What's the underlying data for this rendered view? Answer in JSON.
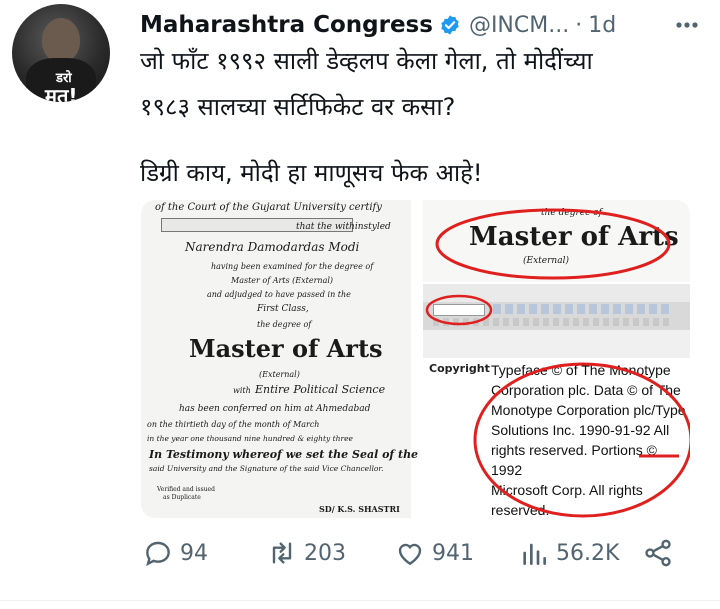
{
  "tweet": {
    "account_name": "Maharashtra Congress",
    "handle": "@INCM...",
    "separator": "·",
    "time": "1d",
    "avatar_text_top": "डरो",
    "avatar_text_bottom": "मत!",
    "lines": [
      "जो फाँट १९९२ साली डेव्हलप केला गेला, तो मोदींच्या",
      "१९८३ सालच्या सर्टिफिकेट वर कसा?",
      "डिग्री काय, मोदी हा माणूसच फेक आहे!"
    ]
  },
  "media": {
    "certificate": {
      "line1": "of the Court of the Gujarat University certify",
      "line2": "that the withinstyled",
      "name": "Narendra Damodardas Modi",
      "line3": "having been examined for the degree of",
      "line4": "Master of Arts (External)",
      "line5": "and adjudged to have passed in the",
      "class": "First Class,",
      "line6": "the degree of",
      "degree": "Master of Arts",
      "external": "(External)",
      "subject_prefix": "with",
      "subject": "Entire Political Science",
      "line7": "has been conferred on him at Ahmedabad",
      "line8": "on the thirtieth day of the month of March",
      "line9": "in the year one thousand nine hundred & eighty three",
      "line10": "In Testimony whereof we set the Seal of the",
      "line11": "said University and the Signature of the said Vice Chancellor.",
      "verified": "Verified and issued",
      "verified2": "as Duplicate",
      "signature": "SD/ K.S. SHASTRI"
    },
    "zoom_top": {
      "line1": "the degree of",
      "degree": "Master of Arts",
      "external": "(External)"
    },
    "copyright": {
      "label": "Copyright",
      "lines": [
        "Typeface © of The Monotype",
        "Corporation plc. Data © of The",
        "Monotype Corporation plc/Type",
        "Solutions Inc. 1990-91-92 All",
        "rights reserved. Portions © 1992",
        "Microsoft Corp. All rights",
        "reserved."
      ]
    },
    "accent_red": "#e0201f"
  },
  "actions": {
    "replies": "94",
    "retweets": "203",
    "likes": "941",
    "views": "56.2K"
  }
}
